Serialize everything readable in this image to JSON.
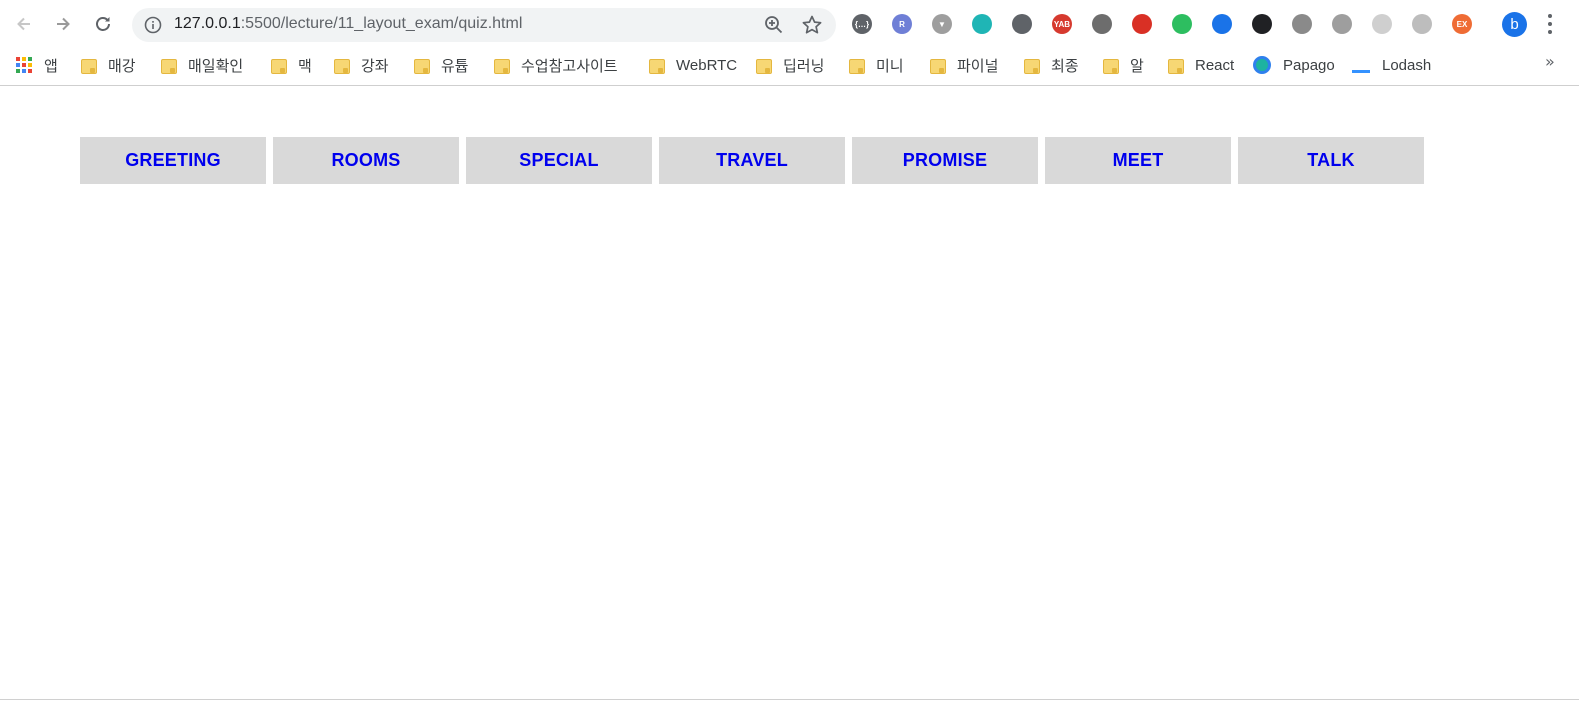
{
  "browser": {
    "url_host": "127.0.0.1",
    "url_rest": ":5500/lecture/11_layout_exam/quiz.html",
    "profile_initial": "b",
    "extensions": [
      {
        "name": "code-ext-icon",
        "color": "#5f6368",
        "label": "{…}"
      },
      {
        "name": "r-ext-icon",
        "color": "#6f7fd6",
        "label": "R"
      },
      {
        "name": "vue-ext-icon",
        "color": "#9e9e9e",
        "label": "▼"
      },
      {
        "name": "teal-ext-icon",
        "color": "#1fb5b5",
        "label": ""
      },
      {
        "name": "monitor-ext-icon",
        "color": "#5f6368",
        "label": ""
      },
      {
        "name": "yab-ext-icon",
        "color": "#d63a2f",
        "label": "YAB"
      },
      {
        "name": "film-ext-icon",
        "color": "#6d6d6d",
        "label": ""
      },
      {
        "name": "stop-ext-icon",
        "color": "#d93025",
        "label": ""
      },
      {
        "name": "evernote-ext-icon",
        "color": "#2dbe60",
        "label": ""
      },
      {
        "name": "picker-ext-icon",
        "color": "#1a73e8",
        "label": ""
      },
      {
        "name": "tampermonkey-ext-icon",
        "color": "#202124",
        "label": ""
      },
      {
        "name": "window-ext-icon",
        "color": "#8a8a8a",
        "label": ""
      },
      {
        "name": "screen-ext-icon",
        "color": "#9e9e9e",
        "label": ""
      },
      {
        "name": "pattern-ext-icon",
        "color": "#cfcfcf",
        "label": ""
      },
      {
        "name": "target-ext-icon",
        "color": "#bdbdbd",
        "label": ""
      },
      {
        "name": "ex-ext-icon",
        "color": "#ef6c35",
        "label": "EX"
      }
    ]
  },
  "bookmarks": {
    "apps_label": "앱",
    "items": [
      {
        "label": "매강",
        "kind": "folder"
      },
      {
        "label": "매일확인",
        "kind": "folder"
      },
      {
        "label": "맥",
        "kind": "folder"
      },
      {
        "label": "강좌",
        "kind": "folder"
      },
      {
        "label": "유튭",
        "kind": "folder"
      },
      {
        "label": "수업참고사이트",
        "kind": "folder"
      },
      {
        "label": "WebRTC",
        "kind": "folder"
      },
      {
        "label": "딥러닝",
        "kind": "folder"
      },
      {
        "label": "미니",
        "kind": "folder"
      },
      {
        "label": "파이널",
        "kind": "folder"
      },
      {
        "label": "최종",
        "kind": "folder"
      },
      {
        "label": "알",
        "kind": "folder"
      },
      {
        "label": "React",
        "kind": "folder"
      },
      {
        "label": "Papago",
        "kind": "papago"
      },
      {
        "label": "Lodash",
        "kind": "lodash"
      }
    ],
    "more": "»"
  },
  "menu": {
    "items": [
      "GREETING",
      "ROOMS",
      "SPECIAL",
      "TRAVEL",
      "PROMISE",
      "MEET",
      "TALK"
    ],
    "item_bg": "#d9d9d9",
    "link_color": "#0000ee"
  }
}
